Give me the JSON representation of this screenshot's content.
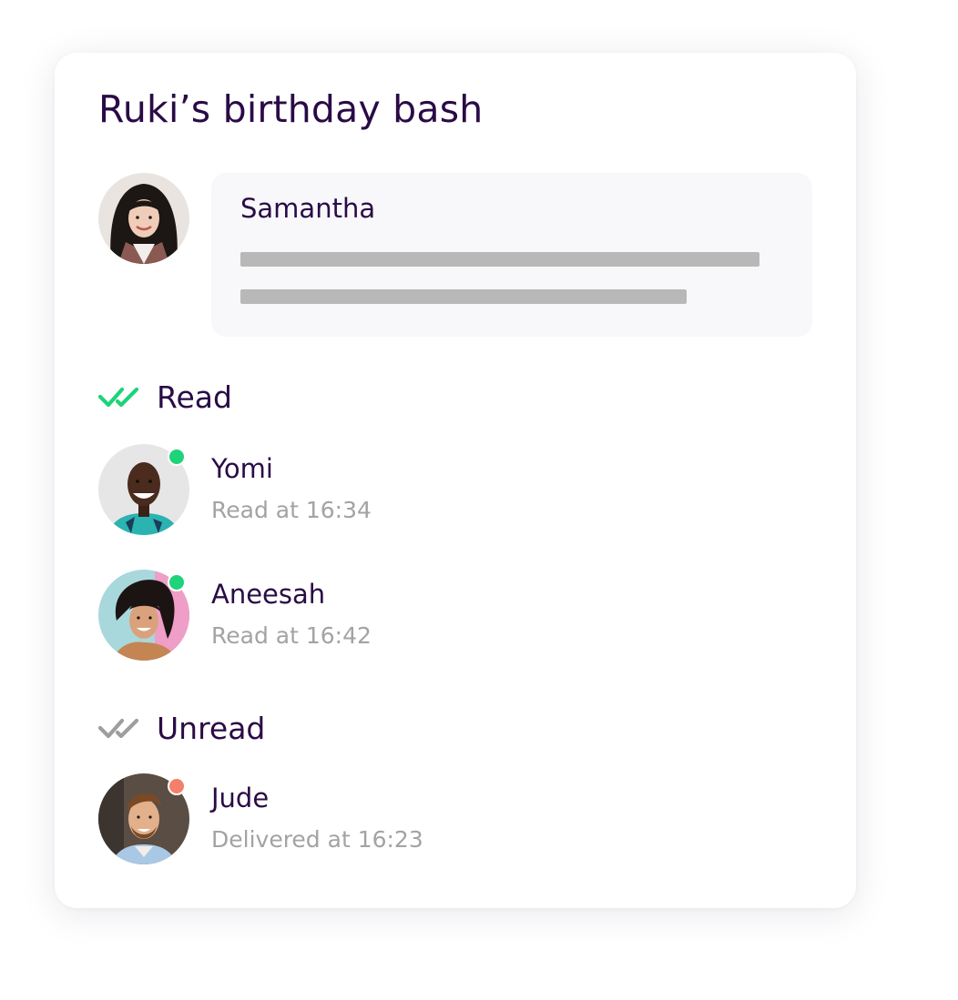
{
  "conversation": {
    "title": "Ruki’s birthday bash"
  },
  "message": {
    "sender": "Samantha"
  },
  "read_section": {
    "label": "Read",
    "icon": "double-check-icon",
    "icon_color": "#1ed37a",
    "people": [
      {
        "name": "Yomi",
        "status": "Read at 16:34",
        "presence": "online"
      },
      {
        "name": "Aneesah",
        "status": "Read at 16:42",
        "presence": "online"
      }
    ]
  },
  "unread_section": {
    "label": "Unread",
    "icon": "double-check-icon",
    "icon_color": "#9e9e9e",
    "people": [
      {
        "name": "Jude",
        "status": "Delivered at 16:23",
        "presence": "away"
      }
    ]
  },
  "colors": {
    "heading": "#2a0b46",
    "secondary_text": "#a3a3a3",
    "online": "#1ed37a",
    "away": "#f47f6b",
    "bubble_bg": "#f8f8fa"
  }
}
